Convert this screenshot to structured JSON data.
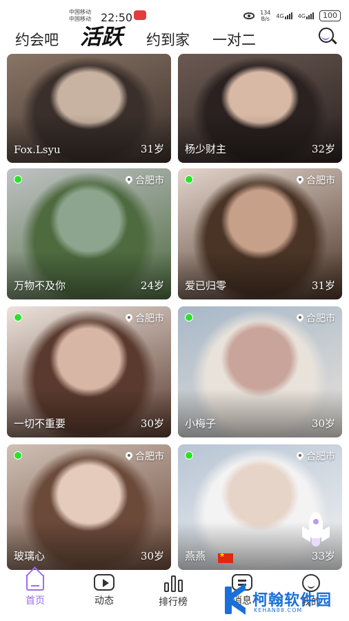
{
  "status_bar": {
    "carrier1": "中国移动",
    "carrier2": "中国移动",
    "time": "22:50",
    "speed_value": "134",
    "speed_unit": "B/s",
    "net1": "4G",
    "net2": "4G",
    "battery": "100"
  },
  "top_tabs": [
    {
      "label": "约会吧"
    },
    {
      "label": "活跃",
      "active": true
    },
    {
      "label": "约到家"
    },
    {
      "label": "一对二"
    }
  ],
  "cards": [
    {
      "name": "Fox.Lsyu",
      "age": "31岁",
      "online": false,
      "location": "",
      "colors": [
        "#8a7566",
        "#c8b3a2",
        "#3a2f2a"
      ]
    },
    {
      "name": "杨少财主",
      "age": "32岁",
      "online": false,
      "location": "",
      "colors": [
        "#6b5a52",
        "#d8b9a5",
        "#2a2120"
      ]
    },
    {
      "name": "万物不及你",
      "age": "24岁",
      "online": true,
      "location": "合肥市",
      "colors": [
        "#bfc2c4",
        "#8da58e",
        "#4e6a3f"
      ]
    },
    {
      "name": "爱已归零",
      "age": "31岁",
      "online": true,
      "location": "合肥市",
      "colors": [
        "#e3d5cc",
        "#c7a08a",
        "#4a3426"
      ]
    },
    {
      "name": "一切不重要",
      "age": "30岁",
      "online": true,
      "location": "合肥市",
      "colors": [
        "#ece3dc",
        "#d7b6a6",
        "#5a3a2e"
      ]
    },
    {
      "name": "小梅子",
      "age": "30岁",
      "online": true,
      "location": "合肥市",
      "colors": [
        "#a7b8c8",
        "#c9a49a",
        "#e8e2da"
      ]
    },
    {
      "name": "玻璃心",
      "age": "30岁",
      "online": true,
      "location": "合肥市",
      "colors": [
        "#cfc0b5",
        "#e4cbbb",
        "#6b4a3a"
      ]
    },
    {
      "name": "燕燕",
      "age": "33岁",
      "online": true,
      "location": "合肥市",
      "colors": [
        "#b8c5d4",
        "#e7d4c8",
        "#f3f3f3"
      ],
      "flag": true
    }
  ],
  "bottom_nav": [
    {
      "label": "首页",
      "icon": "home-icon",
      "active": true
    },
    {
      "label": "动态",
      "icon": "play-icon"
    },
    {
      "label": "排行榜",
      "icon": "ranking-icon"
    },
    {
      "label": "消息",
      "icon": "message-icon"
    },
    {
      "label": "我的",
      "icon": "profile-icon"
    }
  ],
  "watermark": {
    "title": "柯翰软件园",
    "sub": "KEHAN88.COM"
  },
  "accent_color": "#9b6df0"
}
